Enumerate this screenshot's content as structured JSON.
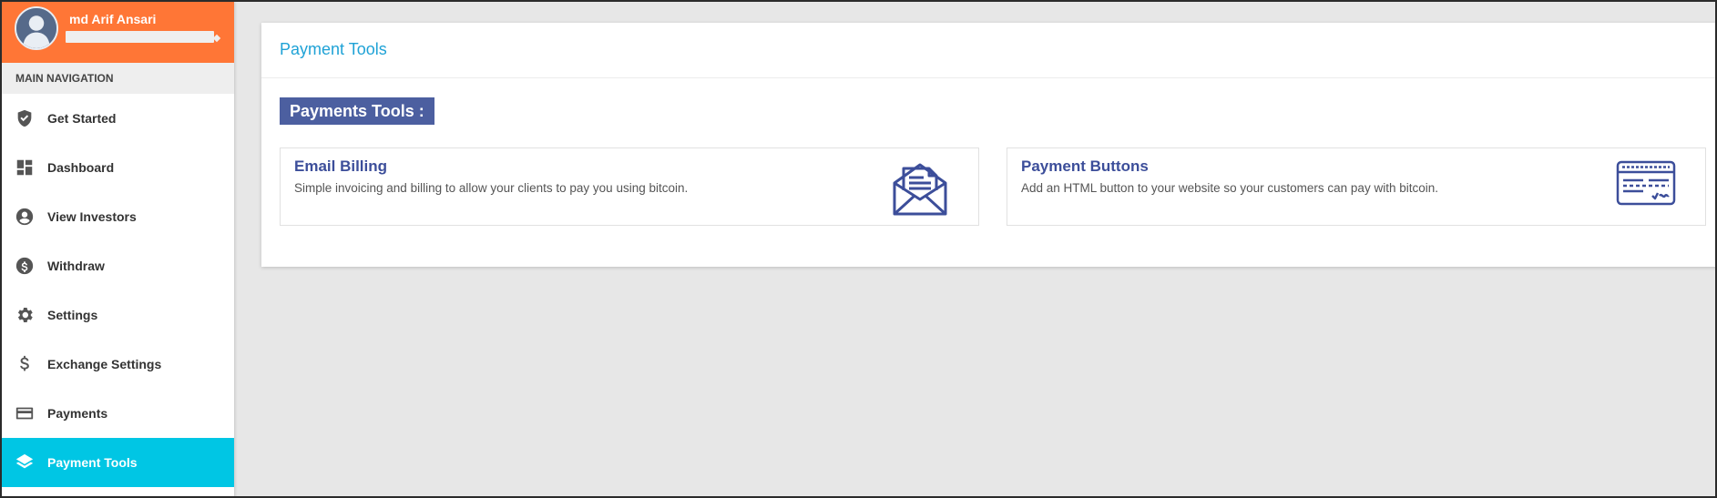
{
  "user": {
    "name": "md Arif Ansari"
  },
  "nav": {
    "header": "MAIN NAVIGATION",
    "items": [
      {
        "label": "Get Started",
        "icon": "shield-check-icon"
      },
      {
        "label": "Dashboard",
        "icon": "dashboard-icon"
      },
      {
        "label": "View Investors",
        "icon": "user-circle-icon"
      },
      {
        "label": "Withdraw",
        "icon": "dollar-circle-icon"
      },
      {
        "label": "Settings",
        "icon": "gear-icon"
      },
      {
        "label": "Exchange Settings",
        "icon": "dollar-icon"
      },
      {
        "label": "Payments",
        "icon": "credit-card-icon"
      },
      {
        "label": "Payment Tools",
        "icon": "layers-icon",
        "active": true
      }
    ]
  },
  "main": {
    "title": "Payment Tools",
    "section_label": "Payments Tools :",
    "tools": [
      {
        "title": "Email Billing",
        "description": "Simple invoicing and billing to allow your clients to pay you using bitcoin.",
        "icon": "envelope-letter-icon"
      },
      {
        "title": "Payment Buttons",
        "description": "Add an HTML button to your website so your customers can pay with bitcoin.",
        "icon": "check-document-icon"
      }
    ]
  },
  "colors": {
    "user_panel": "#ff7636",
    "active_nav": "#00c6e4",
    "header_title": "#1fa2d6",
    "badge": "#4c5fa0",
    "tool_title": "#3c4e9a"
  }
}
